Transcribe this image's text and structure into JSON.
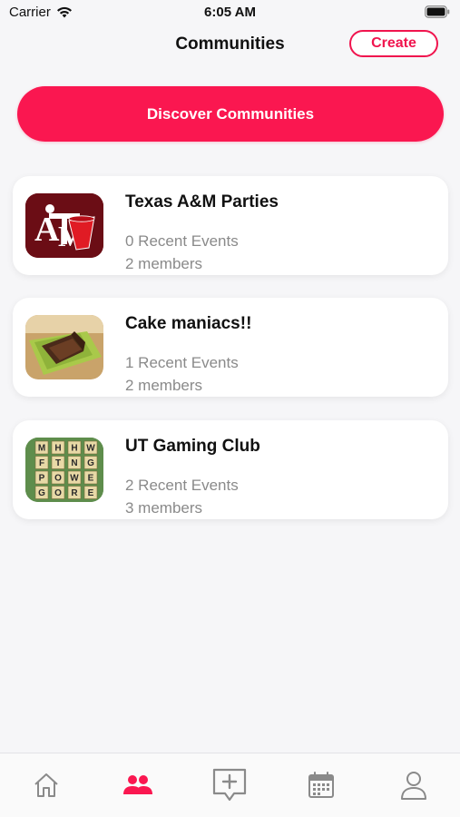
{
  "status_bar": {
    "carrier": "Carrier",
    "time": "6:05 AM"
  },
  "header": {
    "title": "Communities",
    "create_label": "Create"
  },
  "discover": {
    "label": "Discover Communities"
  },
  "communities": [
    {
      "name": "Texas A&M Parties",
      "events": "0 Recent Events",
      "members": "2 members",
      "thumb_icon": "texas-am-logo-icon"
    },
    {
      "name": "Cake maniacs!!",
      "events": "1 Recent Events",
      "members": "2 members",
      "thumb_icon": "cake-photo-icon"
    },
    {
      "name": "UT Gaming Club",
      "events": "2 Recent Events",
      "members": "3 members",
      "thumb_icon": "word-tiles-icon"
    }
  ],
  "tabs": [
    {
      "name": "home",
      "icon": "home-icon",
      "active": false
    },
    {
      "name": "communities",
      "icon": "people-icon",
      "active": true
    },
    {
      "name": "new-post",
      "icon": "add-message-icon",
      "active": false
    },
    {
      "name": "calendar",
      "icon": "calendar-icon",
      "active": false
    },
    {
      "name": "profile",
      "icon": "person-icon",
      "active": false
    }
  ],
  "colors": {
    "accent": "#fa1750",
    "card_bg": "#ffffff",
    "page_bg": "#f6f6f8",
    "muted_text": "#8a8a8a"
  },
  "game_tiles": [
    "M",
    "H",
    "H",
    "W",
    "F",
    "T",
    "N",
    "G",
    "P",
    "O",
    "W",
    "E",
    "G",
    "O",
    "R",
    "E"
  ]
}
